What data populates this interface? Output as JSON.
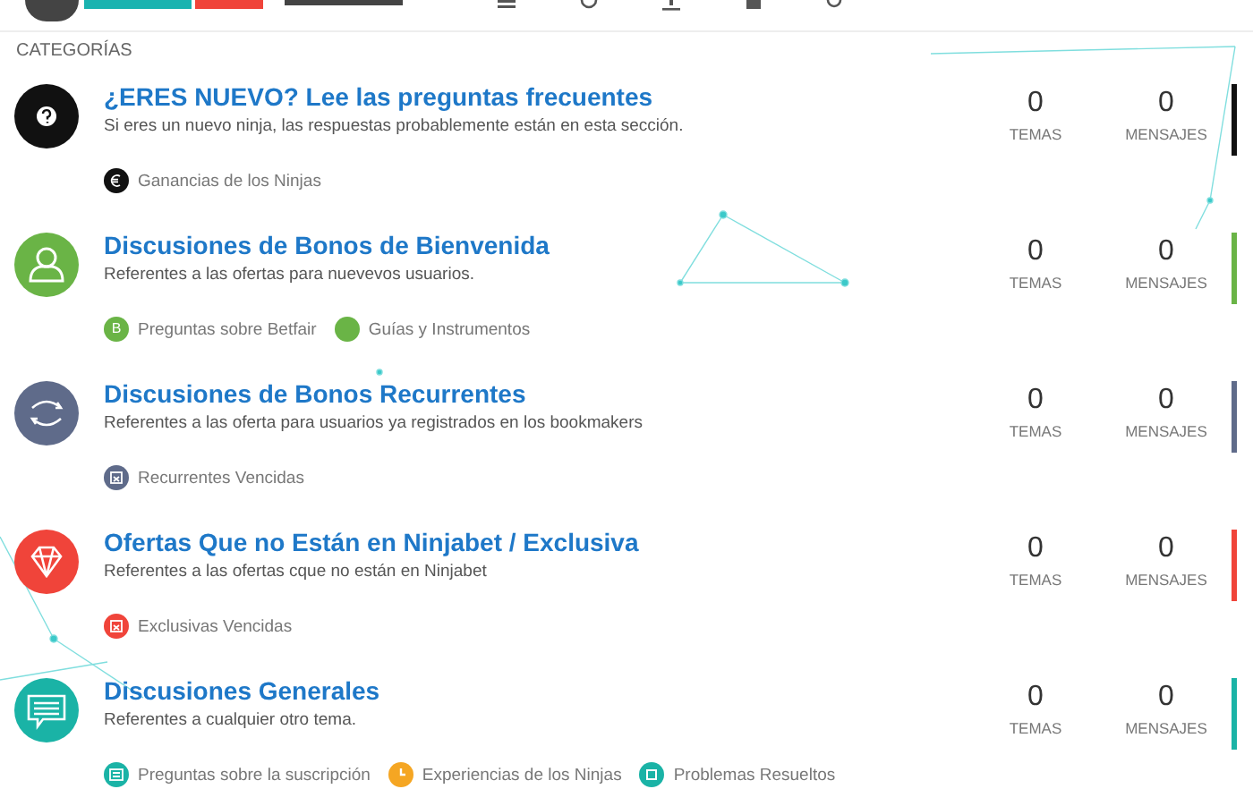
{
  "section_label": "CATEGORÍAS",
  "categories": [
    {
      "kind": "question",
      "color": "#111111",
      "title": "¿ERES NUEVO? Lee las preguntas frecuentes",
      "description": "Si eres un nuevo ninja, las respuestas probablemente están en esta sección.",
      "topics": "0",
      "topics_label": "TEMAS",
      "posts": "0",
      "posts_label": "MENSAJES",
      "subforums": [
        {
          "kind": "euro",
          "color": "#111111",
          "label": "Ganancias de los Ninjas"
        }
      ]
    },
    {
      "kind": "user",
      "color": "#6ab446",
      "title": "Discusiones de Bonos de Bienvenida",
      "description": "Referentes a las ofertas para nuevevos usuarios.",
      "topics": "0",
      "topics_label": "TEMAS",
      "posts": "0",
      "posts_label": "MENSAJES",
      "subforums": [
        {
          "kind": "letter",
          "glyph": "B",
          "color": "#6ab446",
          "label": "Preguntas sobre Betfair"
        },
        {
          "kind": "plain",
          "color": "#6ab446",
          "label": "Guías y Instrumentos"
        }
      ]
    },
    {
      "kind": "refresh",
      "color": "#5f6b8a",
      "title": "Discusiones de Bonos Recurrentes",
      "description": "Referentes a las oferta para usuarios ya registrados en los bookmakers",
      "topics": "0",
      "topics_label": "TEMAS",
      "posts": "0",
      "posts_label": "MENSAJES",
      "subforums": [
        {
          "kind": "calendar",
          "color": "#5f6b8a",
          "label": "Recurrentes Vencidas"
        }
      ]
    },
    {
      "kind": "diamond",
      "color": "#f0443a",
      "title": "Ofertas Que no Están en Ninjabet / Exclusiva",
      "description": "Referentes a las ofertas cque no están en Ninjabet",
      "topics": "0",
      "topics_label": "TEMAS",
      "posts": "0",
      "posts_label": "MENSAJES",
      "subforums": [
        {
          "kind": "calendar",
          "color": "#f0443a",
          "label": "Exclusivas Vencidas"
        }
      ]
    },
    {
      "kind": "chat",
      "color": "#1ab3a6",
      "title": "Discusiones Generales",
      "description": "Referentes a cualquier otro tema.",
      "topics": "0",
      "topics_label": "TEMAS",
      "posts": "0",
      "posts_label": "MENSAJES",
      "subforums": [
        {
          "kind": "list",
          "color": "#1ab3a6",
          "label": "Preguntas sobre la suscripción"
        },
        {
          "kind": "clock",
          "color": "#f5a623",
          "label": "Experiencias de los Ninjas"
        },
        {
          "kind": "square",
          "color": "#1ab3a6",
          "label": "Problemas Resueltos"
        }
      ]
    }
  ]
}
